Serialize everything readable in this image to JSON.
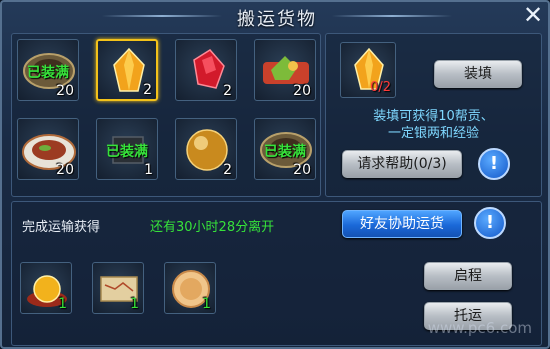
{
  "window": {
    "title": "搬运货物",
    "close_icon": "close-icon"
  },
  "cargo_slots": [
    {
      "icon": "mooncake-plate-icon",
      "status": "已装满",
      "count": "20"
    },
    {
      "icon": "yellow-crystal-icon",
      "status": "",
      "count": "2",
      "selected": true
    },
    {
      "icon": "red-gem-icon",
      "status": "",
      "count": "2"
    },
    {
      "icon": "food-plate-icon",
      "status": "",
      "count": "20"
    },
    {
      "icon": "meat-dish-icon",
      "status": "",
      "count": "20"
    },
    {
      "icon": "dark-scroll-icon",
      "status": "已装满",
      "count": "1"
    },
    {
      "icon": "gold-orb-icon",
      "status": "",
      "count": "2"
    },
    {
      "icon": "mooncake-plate-icon",
      "status": "已装满",
      "count": "20"
    }
  ],
  "selected_item": {
    "icon": "yellow-crystal-icon",
    "progress": "0/2"
  },
  "buttons": {
    "load": "装填",
    "request_help": "请求帮助(0/3)",
    "friend_help": "好友协助运货",
    "depart": "启程",
    "entrust": "托运"
  },
  "load_desc": [
    "装填可获得10帮贡、",
    "一定银两和经验"
  ],
  "bottom": {
    "reward_label": "完成运输获得",
    "time_left": "还有30小时28分离开",
    "rewards": [
      {
        "icon": "gold-orb-plate-icon",
        "count": "1"
      },
      {
        "icon": "map-scroll-icon",
        "count": "1"
      },
      {
        "icon": "pancake-icon",
        "count": "1"
      }
    ]
  },
  "watermark": "www.pc6.com"
}
